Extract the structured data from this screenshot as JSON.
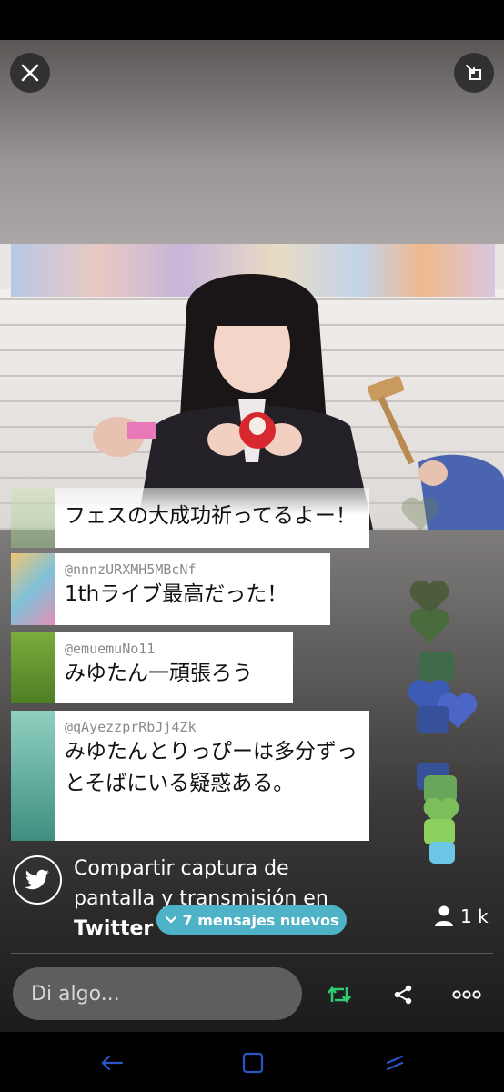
{
  "chat": [
    {
      "username": "",
      "message": "フェスの大成功祈ってるよー！"
    },
    {
      "username": "@nnnzURXMH5MBcNf",
      "message": "1thライブ最高だった！"
    },
    {
      "username": "@emuemuNo11",
      "message": "みゆたん一頑張ろう"
    },
    {
      "username": "@qAyezzprRbJj4Zk",
      "message": "みゆたんとりっぴーは多分ずっとそばにいる疑惑ある。"
    }
  ],
  "share": {
    "text": "Compartir captura de pantalla y transmisión en ",
    "brand": "Twitter"
  },
  "new_messages": {
    "label": "7 mensajes nuevos"
  },
  "viewers": {
    "count": "1 k"
  },
  "input": {
    "placeholder": "Di algo..."
  },
  "colors": {
    "accent": "#4fb3c8",
    "retweet": "#2ecc71",
    "heart_green": "#4a6b3e",
    "heart_blue": "#3b5bb5"
  },
  "icons": [
    "close-icon",
    "minimize-icon",
    "twitter-icon",
    "chevron-down-icon",
    "person-icon",
    "retweet-icon",
    "share-icon",
    "more-icon",
    "back-icon",
    "home-icon",
    "recent-apps-icon",
    "heart-icon",
    "camera-icon"
  ]
}
